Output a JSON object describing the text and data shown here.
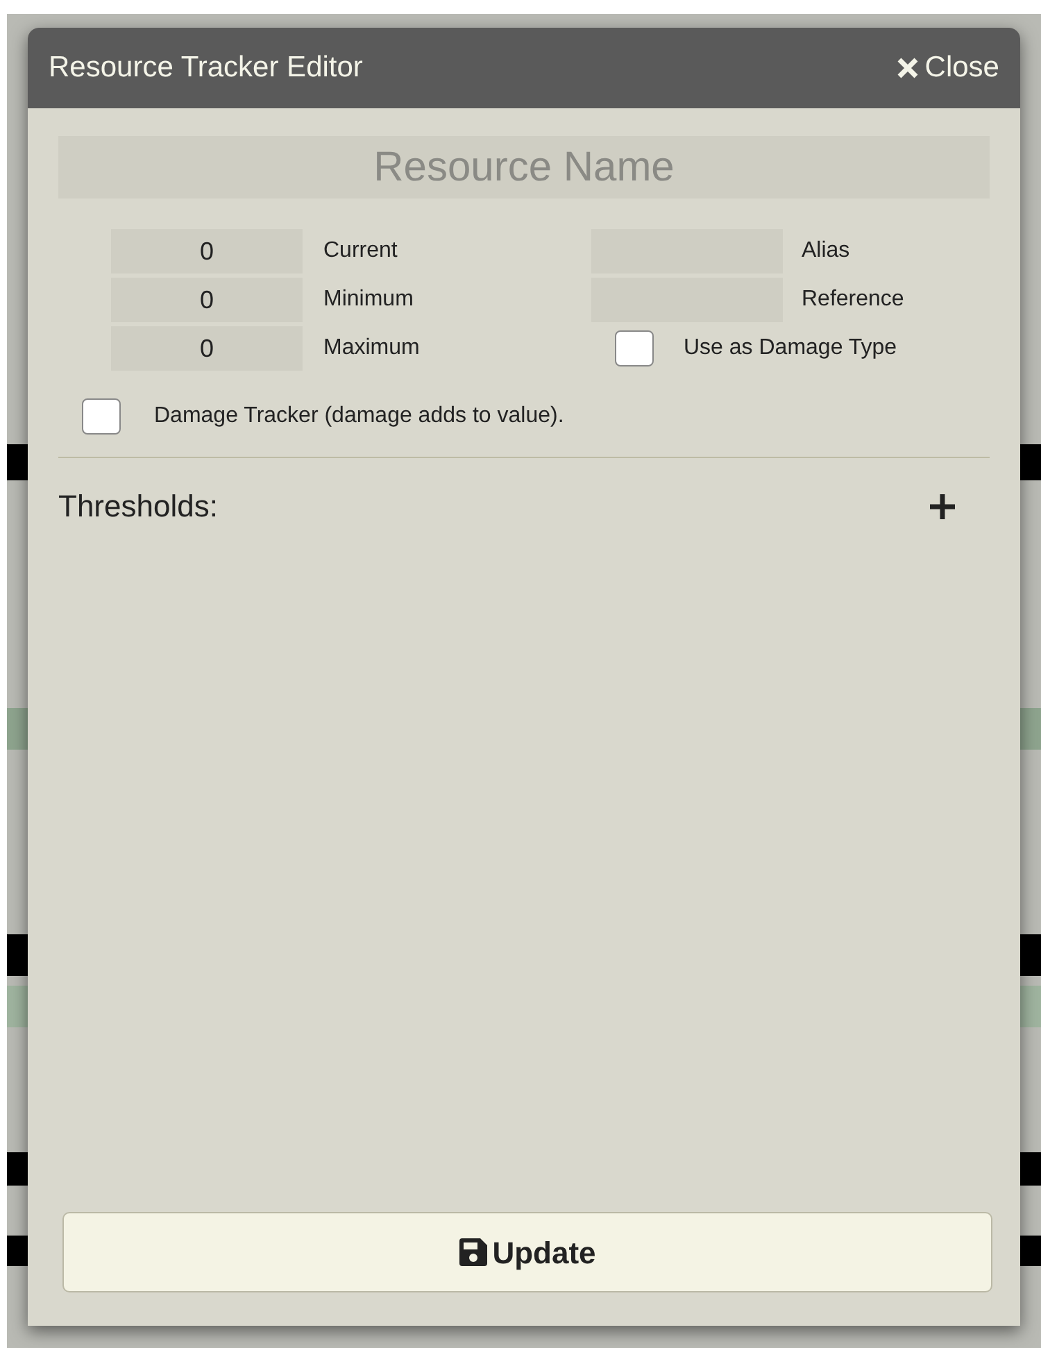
{
  "dialog": {
    "title": "Resource Tracker Editor",
    "close_label": "Close",
    "name_field": {
      "placeholder": "Resource Name"
    },
    "left_fields": [
      {
        "label": "Current",
        "value": "0"
      },
      {
        "label": "Minimum",
        "value": "0"
      },
      {
        "label": "Maximum",
        "value": "0"
      }
    ],
    "right_fields": [
      {
        "label": "Alias"
      },
      {
        "label": "Reference"
      }
    ],
    "use_as_damage_type": {
      "label": "Use as Damage Type",
      "checked": false
    },
    "damage_tracker": {
      "label": "Damage Tracker (damage adds to value).",
      "checked": false
    },
    "thresholds": {
      "label": "Thresholds:"
    },
    "update_button": {
      "label": "Update"
    }
  }
}
